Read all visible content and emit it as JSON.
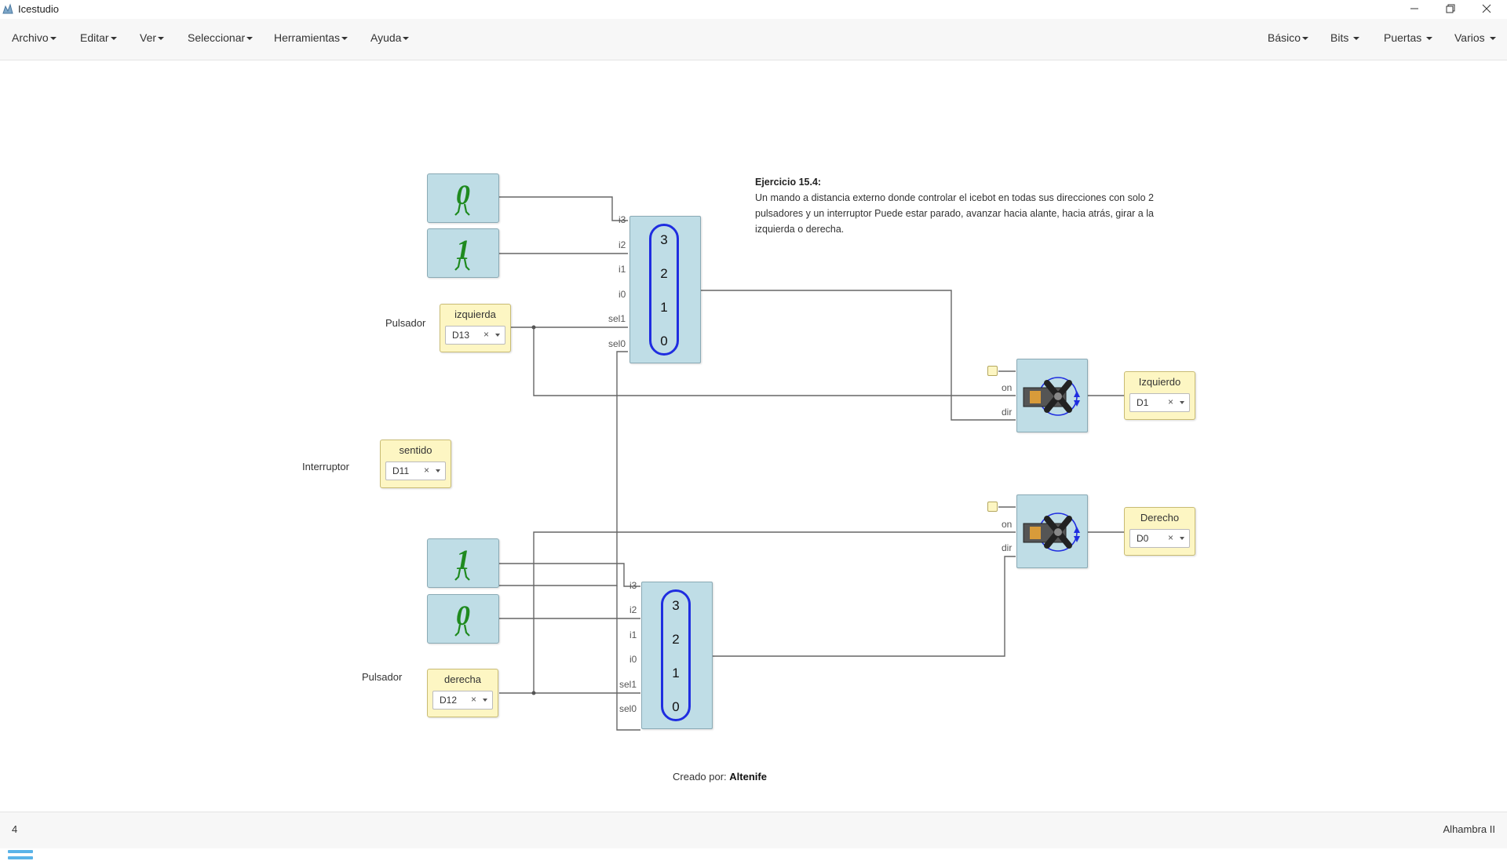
{
  "window": {
    "title": "Icestudio",
    "controls": [
      "minimize-icon",
      "restore-icon",
      "close-icon"
    ]
  },
  "menubar": {
    "left": [
      "Archivo",
      "Editar",
      "Ver",
      "Seleccionar",
      "Herramientas",
      "Ayuda"
    ],
    "right": [
      "Básico",
      "Bits",
      "Puertas",
      "Varios"
    ]
  },
  "comment": {
    "title": "Ejercicio 15.4:",
    "lines": [
      "Un mando a distancia externo donde controlar el icebot en todas sus direcciones con solo 2",
      "pulsadores y un interruptor Puede estar parado, avanzar hacia alante, hacia atrás, girar a la",
      "izquierda o derecha."
    ]
  },
  "constants": {
    "top_a": "0",
    "top_b": "1",
    "bottom_a": "1",
    "bottom_b": "0"
  },
  "inputs": {
    "izquierda": {
      "label": "Pulsador",
      "name": "izquierda",
      "pin": "D13"
    },
    "sentido": {
      "label": "Interruptor",
      "name": "sentido",
      "pin": "D11"
    },
    "derecha": {
      "label": "Pulsador",
      "name": "derecha",
      "pin": "D12"
    }
  },
  "outputs": {
    "izquierdo": {
      "name": "Izquierdo",
      "pin": "D1"
    },
    "derecho": {
      "name": "Derecho",
      "pin": "D0"
    }
  },
  "mux_ports": [
    "i3",
    "i2",
    "i1",
    "i0",
    "sel1",
    "sel0"
  ],
  "mux_values": [
    "3",
    "2",
    "1",
    "0"
  ],
  "servo_ports": [
    "on",
    "dir"
  ],
  "icons": {
    "constant": "walking-digit-icon",
    "servo": "servo-motor-icon",
    "menu": "hamburger-menu-icon"
  },
  "credit": {
    "prefix": "Creado por:",
    "author": "Altenife"
  },
  "footer": {
    "left": "4",
    "right": "Alhambra II"
  },
  "colors": {
    "block_blue": "#bfdde6",
    "io_yellow": "#fdf6c3",
    "mux_oval": "#1f2de0",
    "wire": "#666666",
    "menu_icon": "#5ab3e8",
    "digit_green": "#1f8a1f"
  }
}
